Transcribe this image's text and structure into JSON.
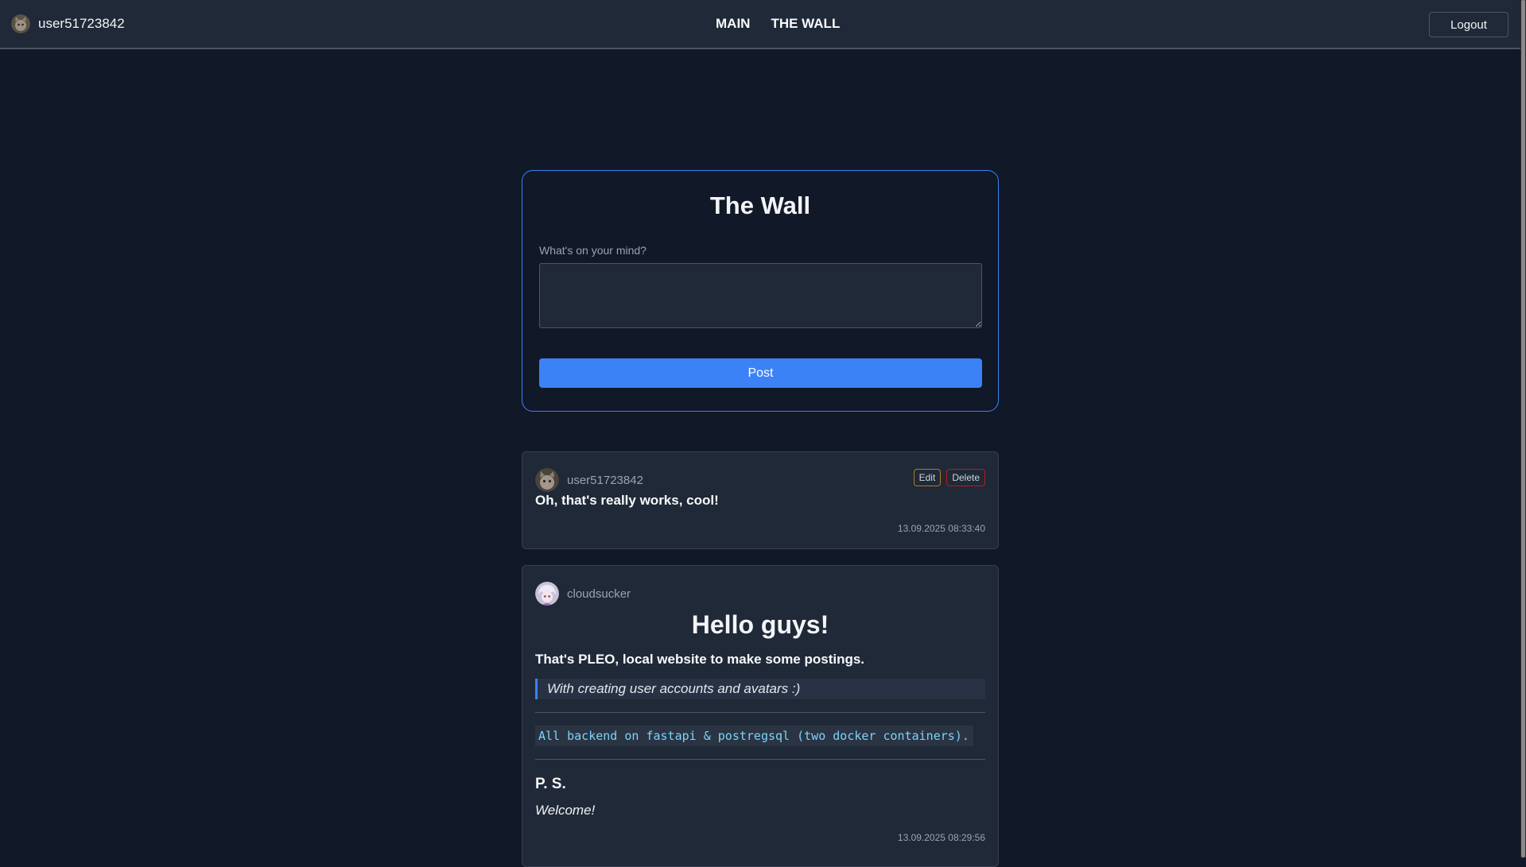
{
  "header": {
    "username": "user51723842",
    "nav": [
      "MAIN",
      "THE WALL"
    ],
    "logout_label": "Logout"
  },
  "composer": {
    "title": "The Wall",
    "label": "What's on your mind?",
    "value": "",
    "post_label": "Post"
  },
  "posts": [
    {
      "author": "user51723842",
      "body": "Oh, that's really works, cool!",
      "timestamp": "13.09.2025 08:33:40",
      "edit_label": "Edit",
      "delete_label": "Delete"
    },
    {
      "author": "cloudsucker",
      "heading": "Hello guys!",
      "strong": "That's PLEO, local website to make some postings.",
      "quote": "With creating user accounts and avatars :)",
      "code": "All backend on fastapi & postregsql (two docker containers).",
      "subheading": "P. S.",
      "emphasis": "Welcome!",
      "timestamp": "13.09.2025 08:29:56"
    }
  ],
  "colors": {
    "background": "#111827",
    "surface": "#1f2937",
    "accent": "#3b82f6",
    "edit_border": "#b7791f",
    "delete_border": "#b91c1c",
    "code_text": "#7dd3fc"
  },
  "icons": {
    "user_avatar": "cat-avatar-icon",
    "cloudsucker_avatar": "anime-avatar-icon"
  }
}
